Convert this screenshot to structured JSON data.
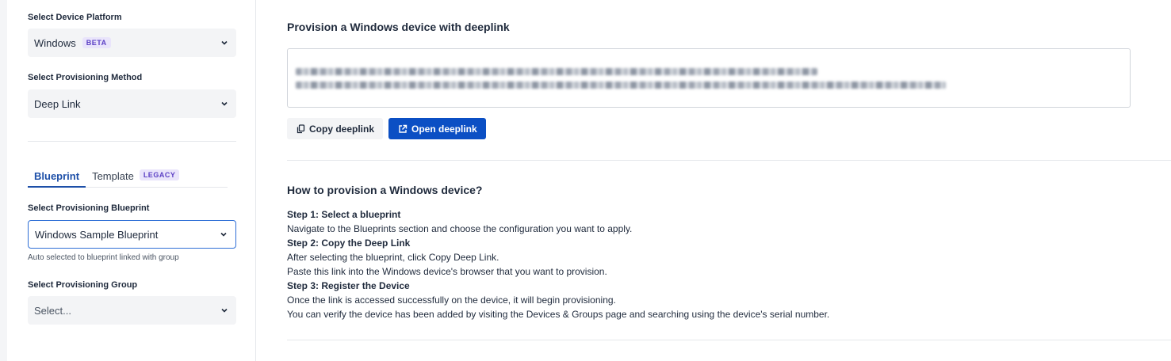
{
  "sidebar": {
    "platform": {
      "label": "Select Device Platform",
      "value": "Windows",
      "badge": "BETA"
    },
    "method": {
      "label": "Select Provisioning Method",
      "value": "Deep Link"
    },
    "tabs": [
      {
        "label": "Blueprint",
        "active": true
      },
      {
        "label": "Template",
        "badge": "LEGACY",
        "active": false
      }
    ],
    "blueprint": {
      "label": "Select Provisioning Blueprint",
      "value": "Windows Sample Blueprint",
      "hint": "Auto selected to blueprint linked with group"
    },
    "group": {
      "label": "Select Provisioning Group",
      "placeholder": "Select..."
    }
  },
  "main": {
    "deeplink_title": "Provision a Windows device with deeplink",
    "copy_button": "Copy deeplink",
    "open_button": "Open deeplink",
    "howto_title": "How to provision a Windows device?",
    "steps": [
      {
        "title": "Step 1: Select a blueprint",
        "lines": [
          "Navigate to the Blueprints section and choose the configuration you want to apply."
        ]
      },
      {
        "title": "Step 2: Copy the Deep Link",
        "lines": [
          "After selecting the blueprint, click Copy Deep Link.",
          "Paste this link into the Windows device's browser that you want to provision."
        ]
      },
      {
        "title": "Step 3: Register the Device",
        "lines": [
          "Once the link is accessed successfully on the device, it will begin provisioning.",
          "You can verify the device has been added by visiting the Devices & Groups page and searching using the device's serial number."
        ]
      }
    ]
  },
  "colors": {
    "accent": "#0b4fc4",
    "badge_bg": "#e9e4fb",
    "badge_text": "#5b3fc4"
  },
  "icons": {
    "dropdown": "chevron-down-icon",
    "copy": "copy-icon",
    "open": "external-link-icon"
  }
}
